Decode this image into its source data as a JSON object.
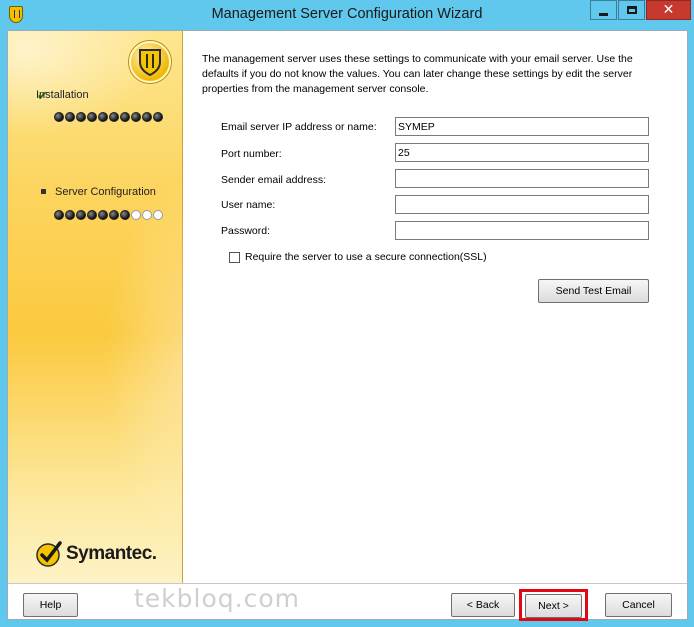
{
  "window": {
    "title": "Management Server Configuration Wizard",
    "icons": {
      "app": "symantec-shield-icon",
      "minimize": "minimize-icon",
      "maximize": "maximize-icon",
      "close": "close-icon"
    },
    "close_glyph": "✕"
  },
  "sidebar": {
    "steps": [
      {
        "label": "Installation",
        "icon": "check-icon",
        "dots_filled": 10,
        "dots_total": 10
      },
      {
        "label": "Server Configuration",
        "icon": "bullet-icon",
        "dots_filled": 7,
        "dots_total": 10
      }
    ],
    "brand": "Symantec."
  },
  "main": {
    "intro": "The management server uses these settings to communicate with your email server.  Use the defaults if you do not know the values. You can later change these settings by edit the server properties from the management server console.",
    "fields": [
      {
        "label": "Email server IP address or name:",
        "value": "SYMEP",
        "placeholder": ""
      },
      {
        "label": "Port number:",
        "value": "25",
        "placeholder": ""
      },
      {
        "label": "Sender email address:",
        "value": "",
        "placeholder": ""
      },
      {
        "label": "User name:",
        "value": "",
        "placeholder": ""
      },
      {
        "label": "Password:",
        "value": "",
        "placeholder": ""
      }
    ],
    "ssl_label": "Require the server to use a secure connection(SSL)",
    "ssl_checked": false,
    "send_test_label": "Send Test Email"
  },
  "footer": {
    "help_label": "Help",
    "back_label": "< Back",
    "next_label": "Next >",
    "cancel_label": "Cancel",
    "watermark": "tekbloq.com",
    "highlight_color": "#e30613"
  }
}
